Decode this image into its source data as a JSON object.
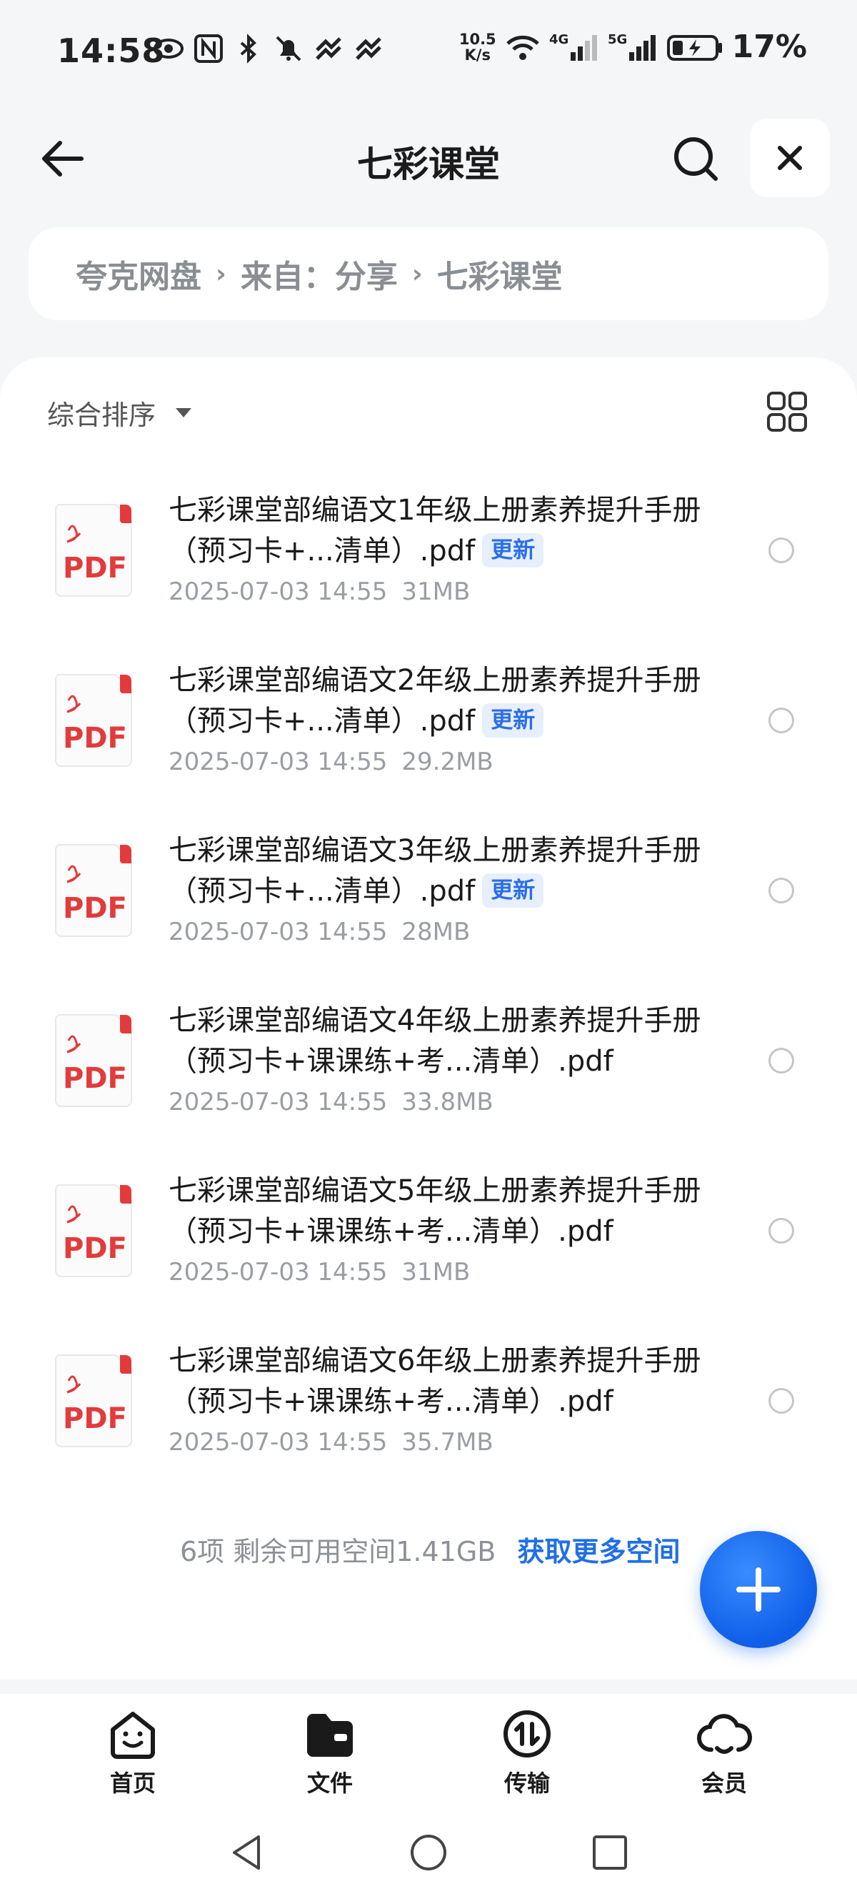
{
  "status_bar": {
    "time": "14:58",
    "net_speed_value": "10.5",
    "net_speed_unit": "K/s",
    "signal_4g": "4G",
    "signal_5g": "5G",
    "battery_percent": "17%"
  },
  "header": {
    "title": "七彩课堂"
  },
  "breadcrumb": {
    "items": [
      "夸克网盘",
      "来自：分享",
      "七彩课堂"
    ],
    "separator": "›"
  },
  "toolbar": {
    "sort_label": "综合排序"
  },
  "files": [
    {
      "name": "七彩课堂部编语文1年级上册素养提升手册（预习卡+...清单）.pdf",
      "badge": "更新",
      "date": "2025-07-03 14:55",
      "size": "31MB"
    },
    {
      "name": "七彩课堂部编语文2年级上册素养提升手册（预习卡+...清单）.pdf",
      "badge": "更新",
      "date": "2025-07-03 14:55",
      "size": "29.2MB"
    },
    {
      "name": "七彩课堂部编语文3年级上册素养提升手册（预习卡+...清单）.pdf",
      "badge": "更新",
      "date": "2025-07-03 14:55",
      "size": "28MB"
    },
    {
      "name": "七彩课堂部编语文4年级上册素养提升手册（预习卡+课课练+考...清单）.pdf",
      "badge": "",
      "date": "2025-07-03 14:55",
      "size": "33.8MB"
    },
    {
      "name": "七彩课堂部编语文5年级上册素养提升手册（预习卡+课课练+考...清单）.pdf",
      "badge": "",
      "date": "2025-07-03 14:55",
      "size": "31MB"
    },
    {
      "name": "七彩课堂部编语文6年级上册素养提升手册（预习卡+课课练+考...清单）.pdf",
      "badge": "",
      "date": "2025-07-03 14:55",
      "size": "35.7MB"
    }
  ],
  "pdf_icon_label": "PDF",
  "footer": {
    "summary": "6项 剩余可用空间1.41GB",
    "more_space_link": "获取更多空间"
  },
  "tabs": [
    {
      "label": "首页",
      "icon": "home-smile-icon"
    },
    {
      "label": "文件",
      "icon": "folder-icon"
    },
    {
      "label": "传输",
      "icon": "transfer-icon"
    },
    {
      "label": "会员",
      "icon": "cloud-member-icon"
    }
  ],
  "colors": {
    "accent": "#1f6fe6",
    "pdf_red": "#e23b3b",
    "badge_bg": "#e7effd"
  }
}
